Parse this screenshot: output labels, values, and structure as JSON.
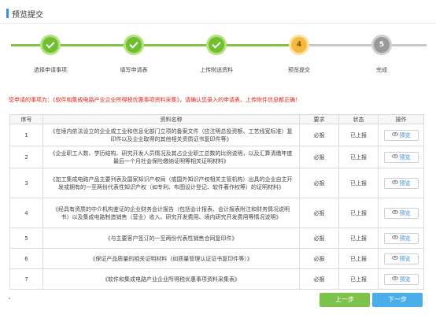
{
  "header": {
    "title": "预览提交"
  },
  "steps": [
    {
      "label": "选择申请事项",
      "state": "done",
      "marker": ""
    },
    {
      "label": "填写申请表",
      "state": "done",
      "marker": ""
    },
    {
      "label": "上传附送资料",
      "state": "done",
      "marker": ""
    },
    {
      "label": "预览提交",
      "state": "active",
      "marker": "4"
    },
    {
      "label": "完成",
      "state": "pending",
      "marker": "5"
    }
  ],
  "notice": "您申请的事项为：《软件和集成电路产业企业所得税优惠事项资料采集》，请确认您录入的申请表、上传附件信息都正确！",
  "table": {
    "headers": {
      "index": "序号",
      "name": "资料名称",
      "required": "要求",
      "status": "状态",
      "action": "操作"
    },
    "rows": [
      {
        "index": "1",
        "name": "《在境内依法设立的企业或工业和信息化部门立项的备案文件（应注明总投资额、工艺线宽标准）复印件以及企业取得的其他相关资质证书复印件等》",
        "required": "必报",
        "status": "已上报",
        "action": "预览"
      },
      {
        "index": "2",
        "name": "《企业职工人数、学历结构、研究开发人员情况及其占企业职工总数的比例说明，以及汇算清缴年度最后一个月社会保险缴纳证明等相关证明材料》",
        "required": "必报",
        "status": "已上报",
        "action": "预览"
      },
      {
        "index": "3",
        "name": "《加工集成电路产品主要列表及国家知识产权局（或国外知识产权相关主管机构）出具的企业自主开发或拥有的一至两份代表性知识产权（如专利、布图设计登记、软件著作权等）的证明材料》",
        "required": "必报",
        "status": "已上报",
        "action": "预览"
      },
      {
        "index": "4",
        "name": "《经具有资质的中介机构鉴证的企业财务会计报告（包括会计报表、会计报表附注和财务情况说明书）以及集成电路制造销售（营业）收入、研究开发费用、境内研究开发费用等情况说明》",
        "required": "必报",
        "status": "已上报",
        "action": "预览"
      },
      {
        "index": "5",
        "name": "《与主要客户签订的一至两份代表性销售合同复印件》",
        "required": "必报",
        "status": "已上报",
        "action": "预览"
      },
      {
        "index": "6",
        "name": "《保证产品质量的相关证明材料（如质量管理认证证书复印件等）》",
        "required": "必报",
        "status": "已上报",
        "action": "预览"
      },
      {
        "index": "7",
        "name": "《软件和集成电路产业企业所得税优惠事项资料采集表》",
        "required": "必报",
        "status": "已上报",
        "action": "预览"
      }
    ]
  },
  "footer": {
    "dot": ".",
    "prev_label": "上一步",
    "next_label": "下一步"
  },
  "colors": {
    "done": "#6fbf2f",
    "active": "#f5b93e",
    "pending": "#999999",
    "notice": "#e2231a",
    "prev": "#7dc34b",
    "next": "#4aaeea"
  }
}
